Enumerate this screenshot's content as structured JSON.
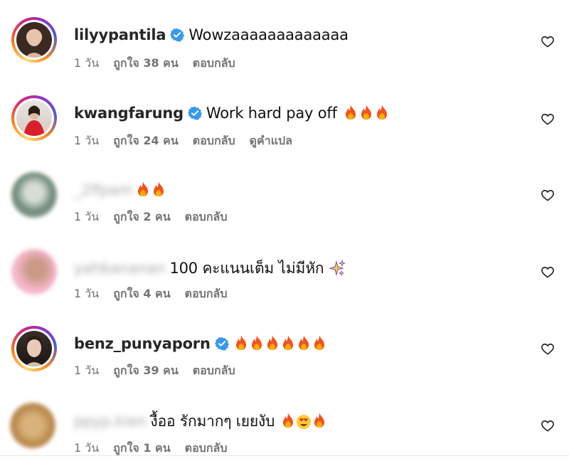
{
  "comments": [
    {
      "username": "lilyypantila",
      "verified": true,
      "text": "Wowzaaaaaaaaaaaaa",
      "emojis": [],
      "time": "1 วัน",
      "likes": "ถูกใจ 38 คน",
      "reply": "ตอบกลับ",
      "extra": ""
    },
    {
      "username": "kwangfarung",
      "verified": true,
      "text": "Work hard pay off",
      "emojis": [
        "fire",
        "fire",
        "fire"
      ],
      "time": "1 วัน",
      "likes": "ถูกใจ 24 คน",
      "reply": "ตอบกลับ",
      "extra": "ดูคำแปล"
    },
    {
      "username": "_2lfpam",
      "verified": false,
      "text": "",
      "emojis": [
        "fire",
        "fire"
      ],
      "time": "1 วัน",
      "likes": "ถูกใจ 2 คน",
      "reply": "ตอบกลับ",
      "extra": ""
    },
    {
      "username": "yahbananan",
      "verified": false,
      "text": "100 คะแนนเต็ม ไม่มีหัก",
      "emojis": [
        "sparkles"
      ],
      "time": "1 วัน",
      "likes": "ถูกใจ 4 คน",
      "reply": "ตอบกลับ",
      "extra": ""
    },
    {
      "username": "benz_punyaporn",
      "verified": true,
      "text": "",
      "emojis": [
        "fire",
        "fire",
        "fire",
        "fire",
        "fire",
        "fire"
      ],
      "time": "1 วัน",
      "likes": "ถูกใจ 39 คน",
      "reply": "ตอบกลับ",
      "extra": ""
    },
    {
      "username": "ppyp.kien",
      "verified": false,
      "text": "งื้ออ รักมากๆ เยยงับ",
      "emojis": [
        "fire",
        "heart-eyes",
        "fire"
      ],
      "time": "1 วัน",
      "likes": "ถูกใจ 1 คน",
      "reply": "ตอบกลับ",
      "extra": ""
    }
  ],
  "colors": {
    "verified": "#3897f0",
    "meta": "#737373",
    "fire_outer": "#f4511e",
    "fire_inner": "#ffb300"
  }
}
